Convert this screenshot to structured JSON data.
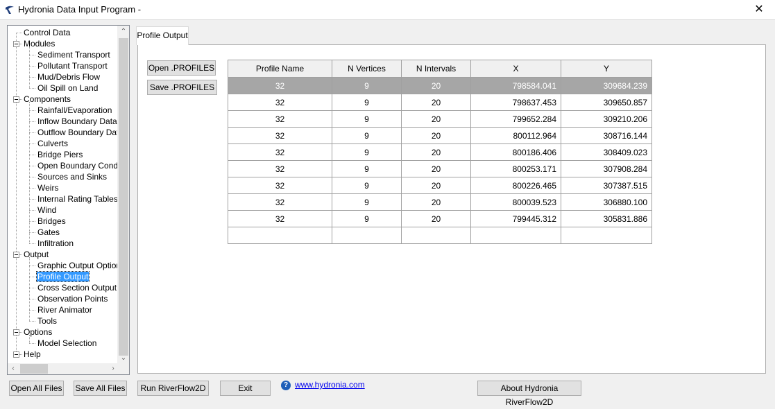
{
  "window": {
    "title": "Hydronia Data Input Program -",
    "close_glyph": "✕"
  },
  "tree": {
    "nodes": [
      {
        "label": "Control Data",
        "level": 0,
        "expandable": false
      },
      {
        "label": "Modules",
        "level": 0,
        "expandable": true
      },
      {
        "label": "Sediment Transport",
        "level": 1
      },
      {
        "label": "Pollutant Transport",
        "level": 1
      },
      {
        "label": "Mud/Debris Flow",
        "level": 1
      },
      {
        "label": "Oil Spill on Land",
        "level": 1
      },
      {
        "label": "Components",
        "level": 0,
        "expandable": true
      },
      {
        "label": "Rainfall/Evaporation",
        "level": 1
      },
      {
        "label": "Inflow Boundary Data",
        "level": 1
      },
      {
        "label": "Outflow Boundary Data",
        "level": 1
      },
      {
        "label": "Culverts",
        "level": 1
      },
      {
        "label": "Bridge Piers",
        "level": 1
      },
      {
        "label": "Open Boundary Conditior",
        "level": 1
      },
      {
        "label": "Sources and Sinks",
        "level": 1
      },
      {
        "label": "Weirs",
        "level": 1
      },
      {
        "label": "Internal Rating Tables",
        "level": 1
      },
      {
        "label": "Wind",
        "level": 1
      },
      {
        "label": "Bridges",
        "level": 1
      },
      {
        "label": "Gates",
        "level": 1
      },
      {
        "label": "Infiltration",
        "level": 1
      },
      {
        "label": "Output",
        "level": 0,
        "expandable": true
      },
      {
        "label": "Graphic Output Options",
        "level": 1
      },
      {
        "label": "Profile Output",
        "level": 1,
        "selected": true
      },
      {
        "label": "Cross Section Output",
        "level": 1
      },
      {
        "label": "Observation Points",
        "level": 1
      },
      {
        "label": "River Animator",
        "level": 1
      },
      {
        "label": "Tools",
        "level": 1
      },
      {
        "label": "Options",
        "level": 0,
        "expandable": true
      },
      {
        "label": "Model Selection",
        "level": 1
      },
      {
        "label": "Help",
        "level": 0,
        "expandable": true
      }
    ]
  },
  "tab": {
    "label": "Profile Output"
  },
  "profile_buttons": {
    "open": "Open .PROFILES",
    "save": "Save .PROFILES"
  },
  "grid": {
    "columns": [
      "Profile Name",
      "N Vertices",
      "N Intervals",
      "X",
      "Y"
    ],
    "rows": [
      [
        "32",
        "9",
        "20",
        "798584.041",
        "309684.239"
      ],
      [
        "32",
        "9",
        "20",
        "798637.453",
        "309650.857"
      ],
      [
        "32",
        "9",
        "20",
        "799652.284",
        "309210.206"
      ],
      [
        "32",
        "9",
        "20",
        "800112.964",
        "308716.144"
      ],
      [
        "32",
        "9",
        "20",
        "800186.406",
        "308409.023"
      ],
      [
        "32",
        "9",
        "20",
        "800253.171",
        "307908.284"
      ],
      [
        "32",
        "9",
        "20",
        "800226.465",
        "307387.515"
      ],
      [
        "32",
        "9",
        "20",
        "800039.523",
        "306880.100"
      ],
      [
        "32",
        "9",
        "20",
        "799445.312",
        "305831.886"
      ]
    ],
    "selected_row": 0
  },
  "bottom": {
    "open_all": "Open All Files",
    "save_all": "Save All Files",
    "run": "Run RiverFlow2D",
    "exit": "Exit",
    "link": "www.hydronia.com",
    "about": "About Hydronia RiverFlow2D"
  },
  "colors": {
    "selection": "#3399ff",
    "grid_selected_row": "#a6a6a6",
    "link": "#0000ee"
  }
}
